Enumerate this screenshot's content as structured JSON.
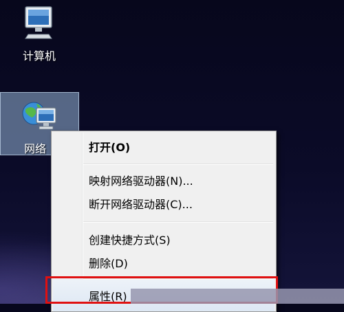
{
  "desktop": {
    "icons": [
      {
        "label": "计算机",
        "icon": "computer-icon"
      },
      {
        "label": "网络",
        "icon": "network-icon"
      }
    ]
  },
  "context_menu": {
    "items": [
      {
        "label": "打开(O)",
        "bold": true
      },
      {
        "label": "映射网络驱动器(N)..."
      },
      {
        "label": "断开网络驱动器(C)..."
      },
      {
        "label": "创建快捷方式(S)"
      },
      {
        "label": "删除(D)"
      },
      {
        "label": "属性(R)"
      }
    ],
    "highlighted_item": "属性(R)",
    "highlight_color": "#e01010"
  }
}
